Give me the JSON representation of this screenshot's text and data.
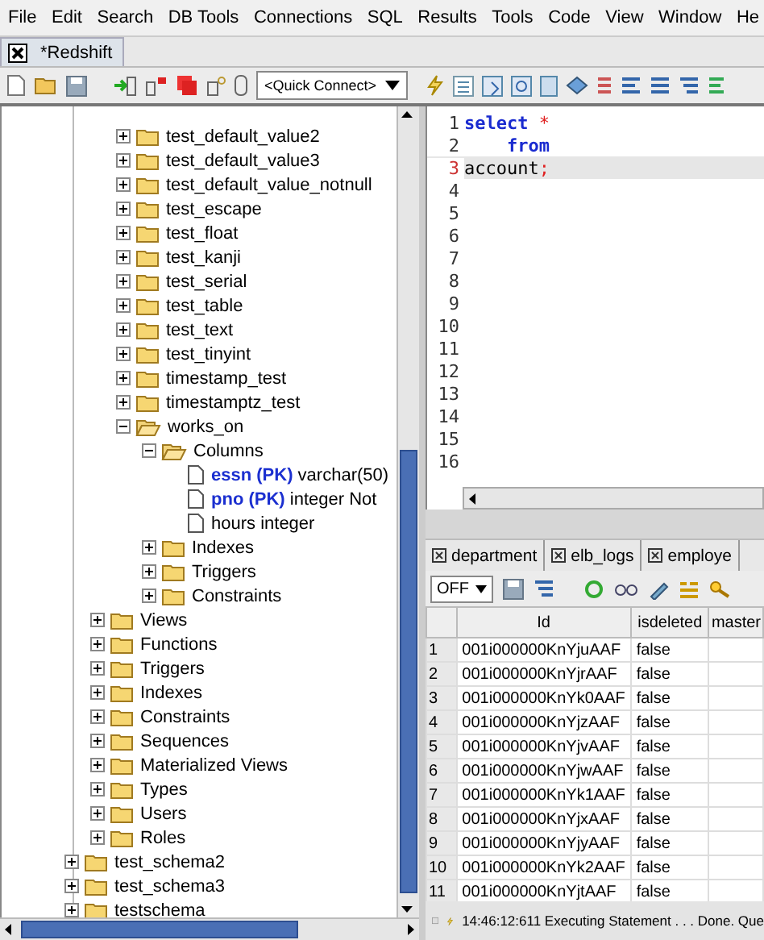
{
  "menu": [
    "File",
    "Edit",
    "Search",
    "DB Tools",
    "Connections",
    "SQL",
    "Results",
    "Tools",
    "Code",
    "View",
    "Window",
    "He"
  ],
  "document_tab": {
    "label": "*Redshift"
  },
  "quick_connect": {
    "value": "<Quick Connect>"
  },
  "tree": [
    {
      "children": [
        {
          "children": [
            {
              "label": "test_default_value2",
              "expanded": false
            },
            {
              "label": "test_default_value3",
              "expanded": false
            },
            {
              "label": "test_default_value_notnull",
              "expanded": false
            },
            {
              "label": "test_escape",
              "expanded": false
            },
            {
              "label": "test_float",
              "expanded": false
            },
            {
              "label": "test_kanji",
              "expanded": false
            },
            {
              "label": "test_serial",
              "expanded": false
            },
            {
              "label": "test_table",
              "expanded": false
            },
            {
              "label": "test_text",
              "expanded": false
            },
            {
              "label": "test_tinyint",
              "expanded": false
            },
            {
              "label": "timestamp_test",
              "expanded": false
            },
            {
              "label": "timestamptz_test",
              "expanded": false
            },
            {
              "label": "works_on",
              "expanded": true,
              "children": [
                {
                  "label": "Columns",
                  "expanded": true,
                  "children": [
                    {
                      "kind": "column",
                      "name": "essn (PK)",
                      "type": "varchar(50)"
                    },
                    {
                      "kind": "column",
                      "name": "pno (PK)",
                      "type": "integer Not"
                    },
                    {
                      "kind": "column",
                      "type": "hours integer"
                    }
                  ]
                },
                {
                  "label": "Indexes",
                  "expanded": false
                },
                {
                  "label": "Triggers",
                  "expanded": false
                },
                {
                  "label": "Constraints",
                  "expanded": false
                }
              ]
            }
          ]
        },
        {
          "label": "Views",
          "expanded": false
        },
        {
          "label": "Functions",
          "expanded": false
        },
        {
          "label": "Triggers",
          "expanded": false
        },
        {
          "label": "Indexes",
          "expanded": false
        },
        {
          "label": "Constraints",
          "expanded": false
        },
        {
          "label": "Sequences",
          "expanded": false
        },
        {
          "label": "Materialized Views",
          "expanded": false
        },
        {
          "label": "Types",
          "expanded": false
        },
        {
          "label": "Users",
          "expanded": false
        },
        {
          "label": "Roles",
          "expanded": false
        }
      ]
    },
    {
      "label": "test_schema2",
      "expanded": false
    },
    {
      "label": "test_schema3",
      "expanded": false
    },
    {
      "label": "testschema",
      "expanded": false
    }
  ],
  "editor": {
    "lines": [
      {
        "number": "1",
        "current": false,
        "tokens": [
          {
            "text": "select",
            "kind": "keyword"
          },
          {
            "text": " *",
            "kind": "operator"
          }
        ]
      },
      {
        "number": "2",
        "current": false,
        "tokens": [
          {
            "text": "    from",
            "kind": "keyword"
          }
        ]
      },
      {
        "number": "3",
        "current": true,
        "tokens": [
          {
            "text": "account",
            "kind": "plain"
          },
          {
            "text": ";",
            "kind": "operator"
          }
        ]
      },
      {
        "number": "4",
        "current": false
      },
      {
        "number": "5",
        "current": false
      },
      {
        "number": "6",
        "current": false
      },
      {
        "number": "7",
        "current": false
      },
      {
        "number": "8",
        "current": false
      },
      {
        "number": "9",
        "current": false
      },
      {
        "number": "10",
        "current": false
      },
      {
        "number": "11",
        "current": false
      },
      {
        "number": "12",
        "current": false
      },
      {
        "number": "13",
        "current": false
      },
      {
        "number": "14",
        "current": false
      },
      {
        "number": "15",
        "current": false
      },
      {
        "number": "16",
        "current": false
      }
    ]
  },
  "result_tabs": [
    "department",
    "elb_logs",
    "employe"
  ],
  "results_toolbar": {
    "mode": "OFF"
  },
  "table": {
    "columns": [
      "Id",
      "isdeleted",
      "master"
    ],
    "rows": [
      {
        "number": "1",
        "cells": [
          "001i000000KnYjuAAF",
          "false"
        ]
      },
      {
        "number": "2",
        "cells": [
          "001i000000KnYjrAAF",
          "false"
        ]
      },
      {
        "number": "3",
        "cells": [
          "001i000000KnYk0AAF",
          "false"
        ]
      },
      {
        "number": "4",
        "cells": [
          "001i000000KnYjzAAF",
          "false"
        ]
      },
      {
        "number": "5",
        "cells": [
          "001i000000KnYjvAAF",
          "false"
        ]
      },
      {
        "number": "6",
        "cells": [
          "001i000000KnYjwAAF",
          "false"
        ]
      },
      {
        "number": "7",
        "cells": [
          "001i000000KnYk1AAF",
          "false"
        ]
      },
      {
        "number": "8",
        "cells": [
          "001i000000KnYjxAAF",
          "false"
        ]
      },
      {
        "number": "9",
        "cells": [
          "001i000000KnYjyAAF",
          "false"
        ]
      },
      {
        "number": "10",
        "cells": [
          "001i000000KnYk2AAF",
          "false"
        ]
      },
      {
        "number": "11",
        "cells": [
          "001i000000KnYjtAAF",
          "false"
        ]
      }
    ]
  },
  "status_bar": {
    "message": "14:46:12:611 Executing Statement . . . Done. Que"
  }
}
